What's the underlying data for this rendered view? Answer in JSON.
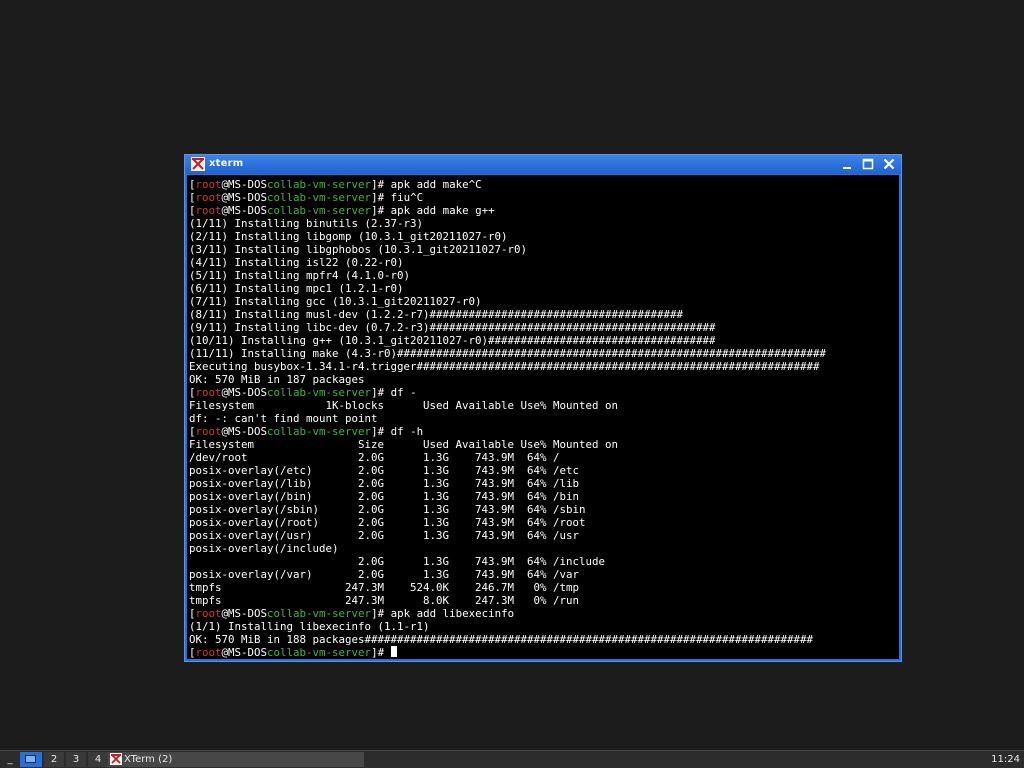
{
  "window": {
    "title": "xterm",
    "icon": "xterm-icon",
    "controls": [
      "minimize-icon",
      "maximize-icon",
      "close-icon"
    ]
  },
  "colors": {
    "titlebar": "#2a6fd6",
    "terminal_bg": "#000000",
    "prompt_user": "#cd3a3a",
    "prompt_dir": "#3fb63f"
  },
  "terminal": {
    "prompt": {
      "open": "[",
      "user": "root",
      "at_host": "@MS-DOS",
      "dir": "collab-vm-server",
      "close": "]# "
    },
    "lines": [
      {
        "type": "prompt",
        "cmd": "apk add make^C"
      },
      {
        "type": "prompt",
        "cmd": "fiu^C"
      },
      {
        "type": "prompt",
        "cmd": "apk add make g++"
      },
      {
        "type": "out",
        "text": "(1/11) Installing binutils (2.37-r3)"
      },
      {
        "type": "out",
        "text": "(2/11) Installing libgomp (10.3.1_git20211027-r0)"
      },
      {
        "type": "out",
        "text": "(3/11) Installing libgphobos (10.3.1_git20211027-r0)"
      },
      {
        "type": "out",
        "text": "(4/11) Installing isl22 (0.22-r0)"
      },
      {
        "type": "out",
        "text": "(5/11) Installing mpfr4 (4.1.0-r0)"
      },
      {
        "type": "out",
        "text": "(6/11) Installing mpc1 (1.2.1-r0)"
      },
      {
        "type": "out",
        "text": "(7/11) Installing gcc (10.3.1_git20211027-r0)"
      },
      {
        "type": "out",
        "text": "(8/11) Installing musl-dev (1.2.2-r7)#######################################"
      },
      {
        "type": "out",
        "text": "(9/11) Installing libc-dev (0.7.2-r3)############################################"
      },
      {
        "type": "out",
        "text": "(10/11) Installing g++ (10.3.1_git20211027-r0)###################################"
      },
      {
        "type": "out",
        "text": "(11/11) Installing make (4.3-r0)##################################################################"
      },
      {
        "type": "out",
        "text": "Executing busybox-1.34.1-r4.trigger##############################################################"
      },
      {
        "type": "out",
        "text": "OK: 570 MiB in 187 packages"
      },
      {
        "type": "prompt",
        "cmd": "df -"
      },
      {
        "type": "out",
        "text": "Filesystem           1K-blocks      Used Available Use% Mounted on"
      },
      {
        "type": "out",
        "text": "df: -: can't find mount point"
      },
      {
        "type": "prompt",
        "cmd": "df -h"
      },
      {
        "type": "out",
        "text": "Filesystem                Size      Used Available Use% Mounted on"
      },
      {
        "type": "out",
        "text": "/dev/root                 2.0G      1.3G    743.9M  64% /"
      },
      {
        "type": "out",
        "text": "posix-overlay(/etc)       2.0G      1.3G    743.9M  64% /etc"
      },
      {
        "type": "out",
        "text": "posix-overlay(/lib)       2.0G      1.3G    743.9M  64% /lib"
      },
      {
        "type": "out",
        "text": "posix-overlay(/bin)       2.0G      1.3G    743.9M  64% /bin"
      },
      {
        "type": "out",
        "text": "posix-overlay(/sbin)      2.0G      1.3G    743.9M  64% /sbin"
      },
      {
        "type": "out",
        "text": "posix-overlay(/root)      2.0G      1.3G    743.9M  64% /root"
      },
      {
        "type": "out",
        "text": "posix-overlay(/usr)       2.0G      1.3G    743.9M  64% /usr"
      },
      {
        "type": "out",
        "text": "posix-overlay(/include)"
      },
      {
        "type": "out",
        "text": "                          2.0G      1.3G    743.9M  64% /include"
      },
      {
        "type": "out",
        "text": "posix-overlay(/var)       2.0G      1.3G    743.9M  64% /var"
      },
      {
        "type": "out",
        "text": "tmpfs                   247.3M    524.0K    246.7M   0% /tmp"
      },
      {
        "type": "out",
        "text": "tmpfs                   247.3M      8.0K    247.3M   0% /run"
      },
      {
        "type": "prompt",
        "cmd": "apk add libexecinfo"
      },
      {
        "type": "out",
        "text": "(1/1) Installing libexecinfo (1.1-r1)"
      },
      {
        "type": "out",
        "text": "OK: 570 MiB in 188 packages#####################################################################"
      },
      {
        "type": "prompt",
        "cmd": "",
        "cursor": true
      }
    ]
  },
  "taskbar": {
    "menu_label": "_",
    "workspaces": [
      "1",
      "2",
      "3",
      "4"
    ],
    "active_workspace": "1",
    "task_label": "XTerm (2)",
    "clock": "11:24"
  }
}
